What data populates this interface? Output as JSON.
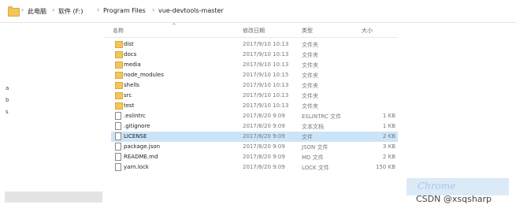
{
  "address_bar": {
    "crumbs": [
      "此电脑",
      "软件 (F:)",
      "Program Files",
      "vue-devtools-master"
    ]
  },
  "left_pane": {
    "glyphs": [
      "a",
      "b",
      "s"
    ]
  },
  "columns": {
    "name": "名称",
    "date": "修改日期",
    "type": "类型",
    "size": "大小"
  },
  "files": [
    {
      "name": "dist",
      "date": "2017/9/10 10:13",
      "type": "文件夹",
      "size": "",
      "kind": "folder"
    },
    {
      "name": "docs",
      "date": "2017/9/10 10:13",
      "type": "文件夹",
      "size": "",
      "kind": "folder"
    },
    {
      "name": "media",
      "date": "2017/9/10 10:13",
      "type": "文件夹",
      "size": "",
      "kind": "folder"
    },
    {
      "name": "node_modules",
      "date": "2017/9/10 10:15",
      "type": "文件夹",
      "size": "",
      "kind": "folder"
    },
    {
      "name": "shells",
      "date": "2017/9/10 10:13",
      "type": "文件夹",
      "size": "",
      "kind": "folder"
    },
    {
      "name": "src",
      "date": "2017/9/10 10:13",
      "type": "文件夹",
      "size": "",
      "kind": "folder"
    },
    {
      "name": "test",
      "date": "2017/9/10 10:13",
      "type": "文件夹",
      "size": "",
      "kind": "folder"
    },
    {
      "name": ".eslintrc",
      "date": "2017/8/20 9:09",
      "type": "ESLINTRC 文件",
      "size": "1 KB",
      "kind": "file"
    },
    {
      "name": ".gitignore",
      "date": "2017/8/20 9:09",
      "type": "文本文档",
      "size": "1 KB",
      "kind": "file"
    },
    {
      "name": "LICENSE",
      "date": "2017/8/20 9:09",
      "type": "文件",
      "size": "2 KB",
      "kind": "file"
    },
    {
      "name": "package.json",
      "date": "2017/8/20 9:09",
      "type": "JSON 文件",
      "size": "3 KB",
      "kind": "file"
    },
    {
      "name": "README.md",
      "date": "2017/8/20 9:09",
      "type": "MD 文件",
      "size": "2 KB",
      "kind": "file"
    },
    {
      "name": "yarn.lock",
      "date": "2017/8/20 9:09",
      "type": "LOCK 文件",
      "size": "150 KB",
      "kind": "file"
    }
  ],
  "selected_index": 9,
  "watermark": {
    "logo_text": "Chrome插件",
    "credit": "CSDN @xsqsharp"
  },
  "colors": {
    "selection": "#cce4f7",
    "folder": "#f3c65a"
  }
}
